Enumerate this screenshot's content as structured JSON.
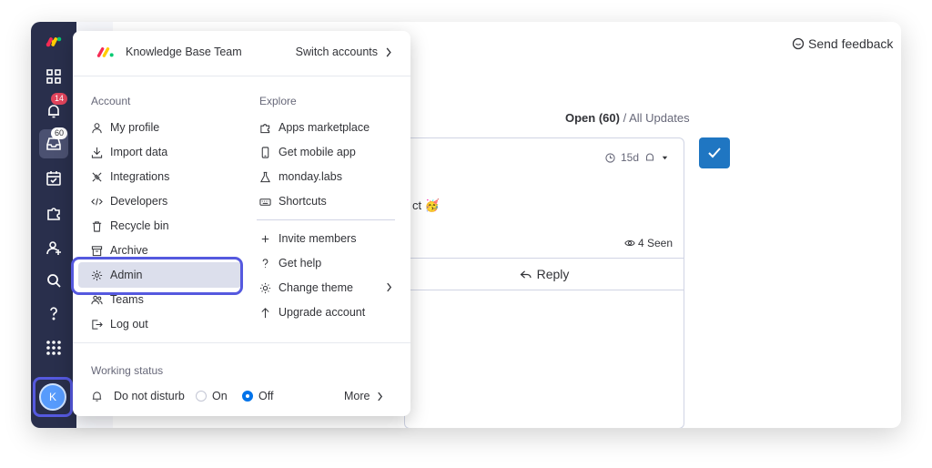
{
  "feedback": {
    "label": "Send feedback"
  },
  "updates": {
    "open_label": "Open (60)",
    "separator": " / ",
    "all_label": "All Updates",
    "card": {
      "age": "15d",
      "text_fragment": "ct 🥳",
      "seen": "4 Seen",
      "reply": "Reply"
    }
  },
  "sidebar": {
    "notifications_badge": "14",
    "inbox_badge": "60",
    "avatar_initial": "K"
  },
  "menu": {
    "team_name": "Knowledge Base Team",
    "switch_accounts": "Switch accounts",
    "account": {
      "title": "Account",
      "items": [
        {
          "label": "My profile",
          "icon": "person-icon"
        },
        {
          "label": "Import data",
          "icon": "download-icon"
        },
        {
          "label": "Integrations",
          "icon": "integrations-icon"
        },
        {
          "label": "Developers",
          "icon": "code-icon"
        },
        {
          "label": "Recycle bin",
          "icon": "trash-icon"
        },
        {
          "label": "Archive",
          "icon": "archive-icon"
        },
        {
          "label": "Admin",
          "icon": "gear-icon"
        },
        {
          "label": "Teams",
          "icon": "teams-icon"
        },
        {
          "label": "Log out",
          "icon": "logout-icon"
        }
      ]
    },
    "explore": {
      "title": "Explore",
      "items": [
        {
          "label": "Apps marketplace",
          "icon": "puzzle-icon"
        },
        {
          "label": "Get mobile app",
          "icon": "mobile-icon"
        },
        {
          "label": "monday.labs",
          "icon": "flask-icon"
        },
        {
          "label": "Shortcuts",
          "icon": "keyboard-icon"
        }
      ],
      "more_items": [
        {
          "label": "Invite members",
          "icon": "plus-icon"
        },
        {
          "label": "Get help",
          "icon": "question-icon"
        },
        {
          "label": "Change theme",
          "icon": "sun-icon"
        },
        {
          "label": "Upgrade account",
          "icon": "arrow-up-icon"
        }
      ]
    },
    "working_status": {
      "title": "Working status",
      "do_not_disturb": "Do not disturb",
      "on_label": "On",
      "off_label": "Off",
      "selected": "Off",
      "more": "More"
    }
  },
  "colors": {
    "sidebar": "#292f4c",
    "highlight_outline": "#5559df",
    "primary": "#0073ea"
  }
}
